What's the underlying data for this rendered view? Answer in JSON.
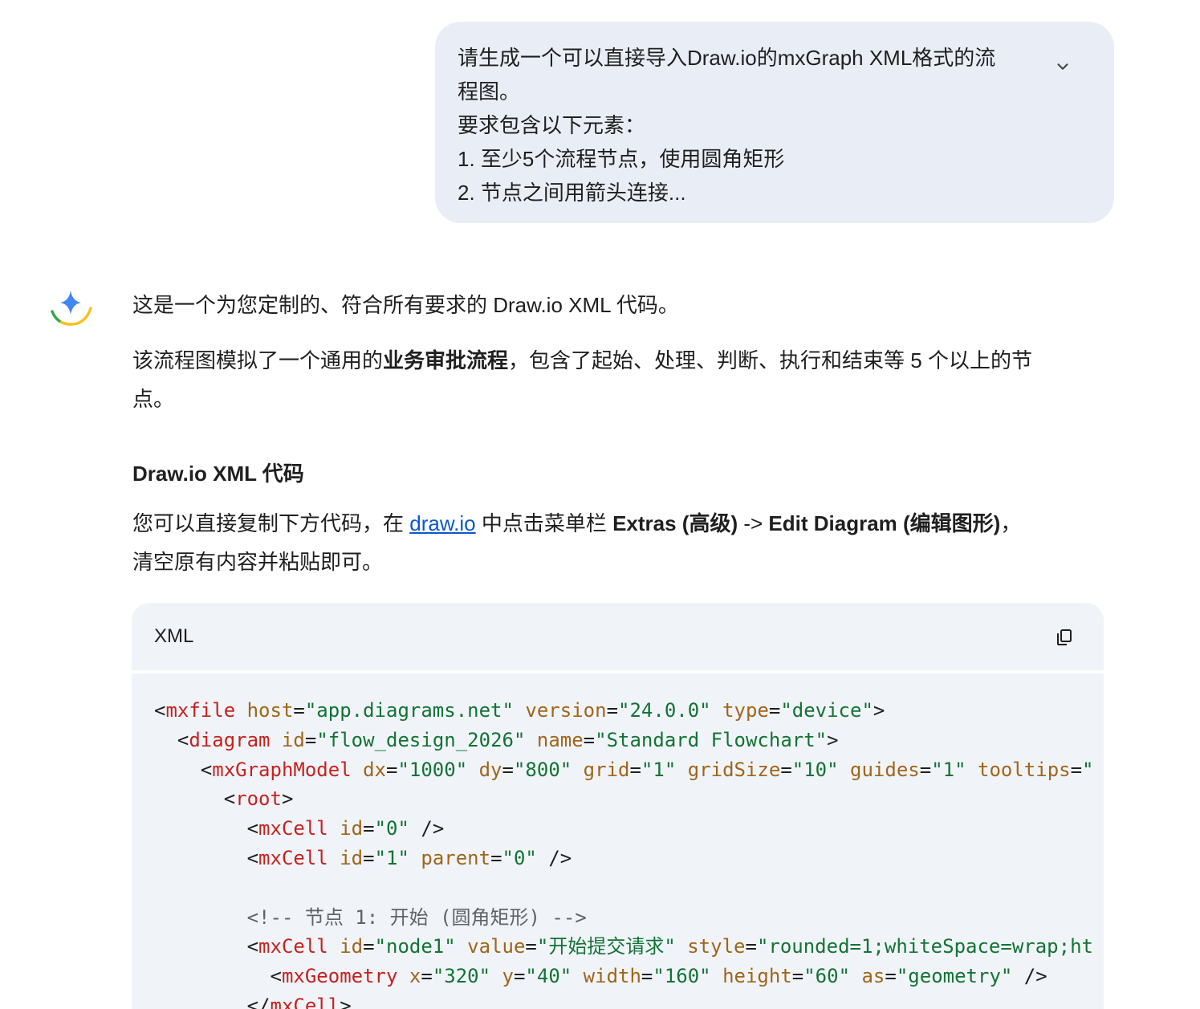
{
  "user_message": {
    "lines": [
      "请生成一个可以直接导入Draw.io的mxGraph XML格式的流",
      "程图。",
      "要求包含以下元素：",
      "1. 至少5个流程节点，使用圆角矩形",
      "2. 节点之间用箭头连接..."
    ]
  },
  "response": {
    "intro": "这是一个为您定制的、符合所有要求的 Draw.io XML 代码。",
    "description": {
      "before": "该流程图模拟了一个通用的",
      "bold": "业务审批流程",
      "after_line1": "，包含了起始、处理、判断、执行和结束等 5 个以上的节",
      "after_line2": "点。"
    },
    "section_title": "Draw.io XML 代码",
    "instructions": {
      "text1": "您可以直接复制下方代码，在 ",
      "link": "draw.io",
      "text2": " 中点击菜单栏 ",
      "bold1": "Extras (高级)",
      "arrow": " -> ",
      "bold2": "Edit Diagram (编辑图形)",
      "text3": "，",
      "line2": "清空原有内容并粘贴即可。"
    }
  },
  "code_block": {
    "language": "XML",
    "lines": [
      [
        [
          "pun",
          "<"
        ],
        [
          "tag",
          "mxfile"
        ],
        [
          "pun",
          " "
        ],
        [
          "attr",
          "host"
        ],
        [
          "pun",
          "="
        ],
        [
          "str",
          "\"app.diagrams.net\""
        ],
        [
          "pun",
          " "
        ],
        [
          "attr",
          "version"
        ],
        [
          "pun",
          "="
        ],
        [
          "str",
          "\"24.0.0\""
        ],
        [
          "pun",
          " "
        ],
        [
          "attr",
          "type"
        ],
        [
          "pun",
          "="
        ],
        [
          "str",
          "\"device\""
        ],
        [
          "pun",
          ">"
        ]
      ],
      [
        [
          "pun",
          "  <"
        ],
        [
          "tag",
          "diagram"
        ],
        [
          "pun",
          " "
        ],
        [
          "attr",
          "id"
        ],
        [
          "pun",
          "="
        ],
        [
          "str",
          "\"flow_design_2026\""
        ],
        [
          "pun",
          " "
        ],
        [
          "attr",
          "name"
        ],
        [
          "pun",
          "="
        ],
        [
          "str",
          "\"Standard Flowchart\""
        ],
        [
          "pun",
          ">"
        ]
      ],
      [
        [
          "pun",
          "    <"
        ],
        [
          "tag",
          "mxGraphModel"
        ],
        [
          "pun",
          " "
        ],
        [
          "attr",
          "dx"
        ],
        [
          "pun",
          "="
        ],
        [
          "str",
          "\"1000\""
        ],
        [
          "pun",
          " "
        ],
        [
          "attr",
          "dy"
        ],
        [
          "pun",
          "="
        ],
        [
          "str",
          "\"800\""
        ],
        [
          "pun",
          " "
        ],
        [
          "attr",
          "grid"
        ],
        [
          "pun",
          "="
        ],
        [
          "str",
          "\"1\""
        ],
        [
          "pun",
          " "
        ],
        [
          "attr",
          "gridSize"
        ],
        [
          "pun",
          "="
        ],
        [
          "str",
          "\"10\""
        ],
        [
          "pun",
          " "
        ],
        [
          "attr",
          "guides"
        ],
        [
          "pun",
          "="
        ],
        [
          "str",
          "\"1\""
        ],
        [
          "pun",
          " "
        ],
        [
          "attr",
          "tooltips"
        ],
        [
          "pun",
          "="
        ],
        [
          "str",
          "\""
        ]
      ],
      [
        [
          "pun",
          "      <"
        ],
        [
          "tag",
          "root"
        ],
        [
          "pun",
          ">"
        ]
      ],
      [
        [
          "pun",
          "        <"
        ],
        [
          "tag",
          "mxCell"
        ],
        [
          "pun",
          " "
        ],
        [
          "attr",
          "id"
        ],
        [
          "pun",
          "="
        ],
        [
          "str",
          "\"0\""
        ],
        [
          "pun",
          " />"
        ]
      ],
      [
        [
          "pun",
          "        <"
        ],
        [
          "tag",
          "mxCell"
        ],
        [
          "pun",
          " "
        ],
        [
          "attr",
          "id"
        ],
        [
          "pun",
          "="
        ],
        [
          "str",
          "\"1\""
        ],
        [
          "pun",
          " "
        ],
        [
          "attr",
          "parent"
        ],
        [
          "pun",
          "="
        ],
        [
          "str",
          "\"0\""
        ],
        [
          "pun",
          " />"
        ]
      ],
      [],
      [
        [
          "com",
          "        <!-- 节点 1: 开始 (圆角矩形) -->"
        ]
      ],
      [
        [
          "pun",
          "        <"
        ],
        [
          "tag",
          "mxCell"
        ],
        [
          "pun",
          " "
        ],
        [
          "attr",
          "id"
        ],
        [
          "pun",
          "="
        ],
        [
          "str",
          "\"node1\""
        ],
        [
          "pun",
          " "
        ],
        [
          "attr",
          "value"
        ],
        [
          "pun",
          "="
        ],
        [
          "str",
          "\"开始提交请求\""
        ],
        [
          "pun",
          " "
        ],
        [
          "attr",
          "style"
        ],
        [
          "pun",
          "="
        ],
        [
          "str",
          "\"rounded=1;whiteSpace=wrap;ht"
        ]
      ],
      [
        [
          "pun",
          "          <"
        ],
        [
          "tag",
          "mxGeometry"
        ],
        [
          "pun",
          " "
        ],
        [
          "attr",
          "x"
        ],
        [
          "pun",
          "="
        ],
        [
          "str",
          "\"320\""
        ],
        [
          "pun",
          " "
        ],
        [
          "attr",
          "y"
        ],
        [
          "pun",
          "="
        ],
        [
          "str",
          "\"40\""
        ],
        [
          "pun",
          " "
        ],
        [
          "attr",
          "width"
        ],
        [
          "pun",
          "="
        ],
        [
          "str",
          "\"160\""
        ],
        [
          "pun",
          " "
        ],
        [
          "attr",
          "height"
        ],
        [
          "pun",
          "="
        ],
        [
          "str",
          "\"60\""
        ],
        [
          "pun",
          " "
        ],
        [
          "attr",
          "as"
        ],
        [
          "pun",
          "="
        ],
        [
          "str",
          "\"geometry\""
        ],
        [
          "pun",
          " />"
        ]
      ],
      [
        [
          "pun",
          "        </"
        ],
        [
          "tag",
          "mxCell"
        ],
        [
          "pun",
          ">"
        ]
      ]
    ]
  },
  "colors": {
    "bubble_bg": "#e9eef6",
    "code_bg": "#f0f4f9",
    "link": "#0b57d0",
    "tag": "#c5221f",
    "attr": "#a0651a",
    "string": "#137333",
    "comment": "#5f6368"
  },
  "icons": {
    "expand": "chevron-down-icon",
    "assistant": "gemini-sparkle-icon",
    "copy": "copy-icon"
  }
}
